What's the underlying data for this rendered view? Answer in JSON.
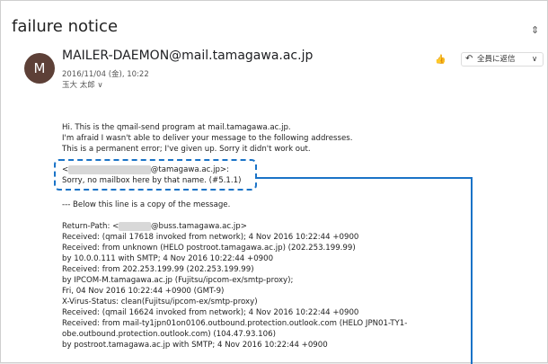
{
  "subject": "failure notice",
  "collapse_icon": "⇕",
  "avatar_letter": "M",
  "sender": "MAILER-DAEMON@mail.tamagawa.ac.jp",
  "date": "2016/11/04 (金), 10:22",
  "to": "玉大 太郎 ∨",
  "reply_all": "全員に返信",
  "reply_icon": "↶",
  "more_icon": "∨",
  "thumb_icon": "👍",
  "body": {
    "intro1": "Hi. This is the qmail-send program at mail.tamagawa.ac.jp.",
    "intro2": "I'm afraid I wasn't able to deliver your message to the following addresses.",
    "intro3": "This is a permanent error; I've given up. Sorry it didn't work out.",
    "addr_prefix": "<",
    "addr_blur": "xxxxxxxxxxxxxxxxxx",
    "addr_suffix": "@tamagawa.ac.jp>:",
    "sorry": "Sorry, no mailbox here by that name. (#5.1.1)",
    "copy_line": "--- Below this line is a copy of the message.",
    "return_prefix": "Return-Path: <",
    "return_blur": "xxxxxxx",
    "return_suffix": "@buss.tamagawa.ac.jp>",
    "lines": [
      "Received: (qmail 17618 invoked from network); 4 Nov 2016 10:22:44 +0900",
      "Received: from unknown (HELO postroot.tamagawa.ac.jp) (202.253.199.99)",
      "  by 10.0.0.111 with SMTP; 4 Nov 2016 10:22:44 +0900",
      "Received: from 202.253.199.99 (202.253.199.99)",
      " by IPCOM-M.tamagawa.ac.jp (Fujitsu/ipcom-ex/smtp-proxy);",
      " Fri, 04 Nov 2016 10:22:44 +0900 (GMT-9)",
      "X-Virus-Status: clean(Fujitsu/ipcom-ex/smtp-proxy)",
      "Received: (qmail 16624 invoked from network); 4 Nov 2016 10:22:44 +0900",
      "Received: from mail-ty1jpn01on0106.outbound.protection.outlook.com (HELO JPN01-TY1-",
      "obe.outbound.protection.outlook.com) (104.47.93.106)",
      "  by postroot.tamagawa.ac.jp with SMTP; 4 Nov 2016 10:22:44 +0900"
    ]
  },
  "colors": {
    "highlight": "#1a73c7",
    "avatar_bg": "#5d4037"
  }
}
